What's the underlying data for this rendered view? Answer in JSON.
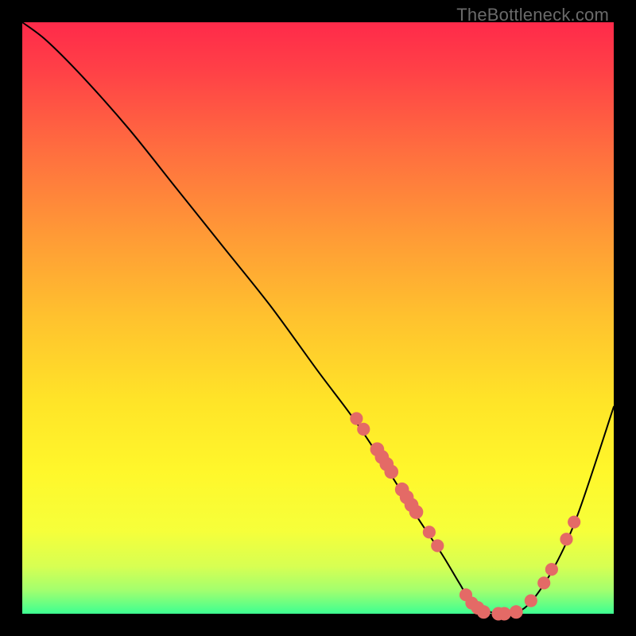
{
  "attribution": "TheBottleneck.com",
  "colors": {
    "dot": "#e46a66",
    "curve": "#000000"
  },
  "chart_data": {
    "type": "line",
    "title": "",
    "xlabel": "",
    "ylabel": "",
    "xlim": [
      0,
      100
    ],
    "ylim": [
      0,
      100
    ],
    "grid": false,
    "legend": false,
    "series": [
      {
        "name": "bottleneck-curve",
        "x": [
          0,
          4,
          10,
          18,
          26,
          34,
          42,
          50,
          56,
          62,
          67,
          71,
          74,
          76,
          80,
          83,
          86,
          90,
          94,
          100
        ],
        "y": [
          100,
          97,
          91,
          82,
          72,
          62,
          52,
          41,
          33,
          24,
          16,
          10,
          5,
          2,
          0,
          0,
          2,
          8,
          17,
          35
        ]
      }
    ],
    "markers": [
      {
        "x": 56.5,
        "y": 33.0,
        "r": 1.1
      },
      {
        "x": 57.7,
        "y": 31.2,
        "r": 1.1
      },
      {
        "x": 60.0,
        "y": 27.8,
        "r": 1.3
      },
      {
        "x": 60.8,
        "y": 26.5,
        "r": 1.3
      },
      {
        "x": 61.6,
        "y": 25.3,
        "r": 1.3
      },
      {
        "x": 62.4,
        "y": 24.0,
        "r": 1.3
      },
      {
        "x": 64.2,
        "y": 21.0,
        "r": 1.3
      },
      {
        "x": 65.0,
        "y": 19.7,
        "r": 1.3
      },
      {
        "x": 65.8,
        "y": 18.4,
        "r": 1.3
      },
      {
        "x": 66.6,
        "y": 17.2,
        "r": 1.3
      },
      {
        "x": 68.8,
        "y": 13.8,
        "r": 1.1
      },
      {
        "x": 70.2,
        "y": 11.5,
        "r": 1.1
      },
      {
        "x": 75.0,
        "y": 3.2,
        "r": 1.1
      },
      {
        "x": 76.0,
        "y": 1.8,
        "r": 1.1
      },
      {
        "x": 77.0,
        "y": 1.0,
        "r": 1.2
      },
      {
        "x": 78.0,
        "y": 0.3,
        "r": 1.2
      },
      {
        "x": 80.5,
        "y": 0.0,
        "r": 1.2
      },
      {
        "x": 81.5,
        "y": 0.0,
        "r": 1.2
      },
      {
        "x": 83.5,
        "y": 0.3,
        "r": 1.2
      },
      {
        "x": 86.0,
        "y": 2.2,
        "r": 1.1
      },
      {
        "x": 88.2,
        "y": 5.2,
        "r": 1.1
      },
      {
        "x": 89.5,
        "y": 7.5,
        "r": 1.1
      },
      {
        "x": 92.0,
        "y": 12.6,
        "r": 1.1
      },
      {
        "x": 93.3,
        "y": 15.5,
        "r": 1.1
      }
    ]
  }
}
